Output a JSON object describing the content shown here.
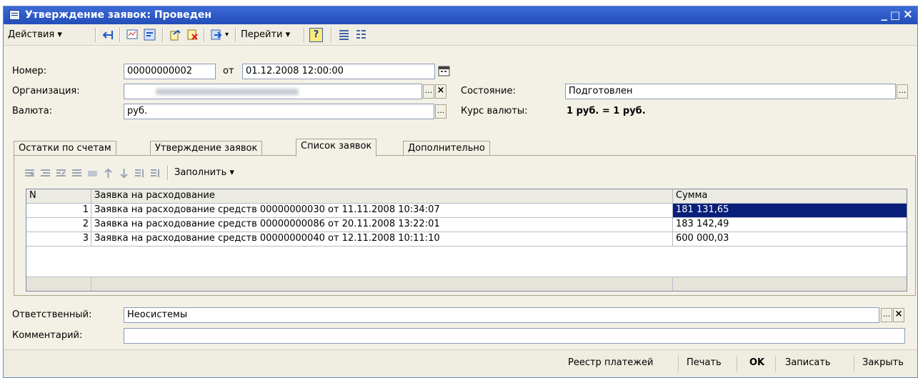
{
  "window": {
    "title": "Утверждение заявок: Проведен",
    "minimize": "_",
    "maximize": "□",
    "close": "×"
  },
  "toolbar": {
    "actions_label": "Действия ▾",
    "goto_label": "Перейти ▾",
    "help_label": "?"
  },
  "form": {
    "number_label": "Номер:",
    "number_value": "00000000002",
    "from_label": "от",
    "date_value": "01.12.2008 12:00:00",
    "org_label": "Организация:",
    "status_label": "Состояние:",
    "status_value": "Подготовлен",
    "currency_label": "Валюта:",
    "currency_value": "руб.",
    "rate_label": "Курс валюты:",
    "rate_value": "1 руб. = 1 руб.",
    "select_btn": "...",
    "clear_btn": "×"
  },
  "tabs": [
    {
      "label": "Остатки по счетам"
    },
    {
      "label": "Утверждение заявок"
    },
    {
      "label": "Список заявок"
    },
    {
      "label": "Дополнительно"
    }
  ],
  "tab_toolbar": {
    "fill_label": "Заполнить ▾"
  },
  "table": {
    "columns": [
      "N",
      "Заявка на расходование",
      "Сумма"
    ],
    "rows": [
      {
        "n": "1",
        "request": "Заявка на расходование средств 00000000030 от 11.11.2008 10:34:07",
        "sum": "181 131,65"
      },
      {
        "n": "2",
        "request": "Заявка на расходование средств 00000000086 от 20.11.2008 13:22:01",
        "sum": "183 142,49"
      },
      {
        "n": "3",
        "request": "Заявка на расходование средств 00000000040 от 12.11.2008 10:11:10",
        "sum": "600 000,03"
      }
    ]
  },
  "responsible": {
    "label": "Ответственный:",
    "value": "Неосистемы"
  },
  "comment": {
    "label": "Комментарий:",
    "value": ""
  },
  "bottom_buttons": {
    "payments_registry": "Реестр платежей",
    "print": "Печать",
    "ok": "OK",
    "save": "Записать",
    "close": "Закрыть"
  },
  "colors": {
    "titlebar": "#2c58c6",
    "selection": "#0a1f7a",
    "form_bg": "#f3f1e6"
  }
}
